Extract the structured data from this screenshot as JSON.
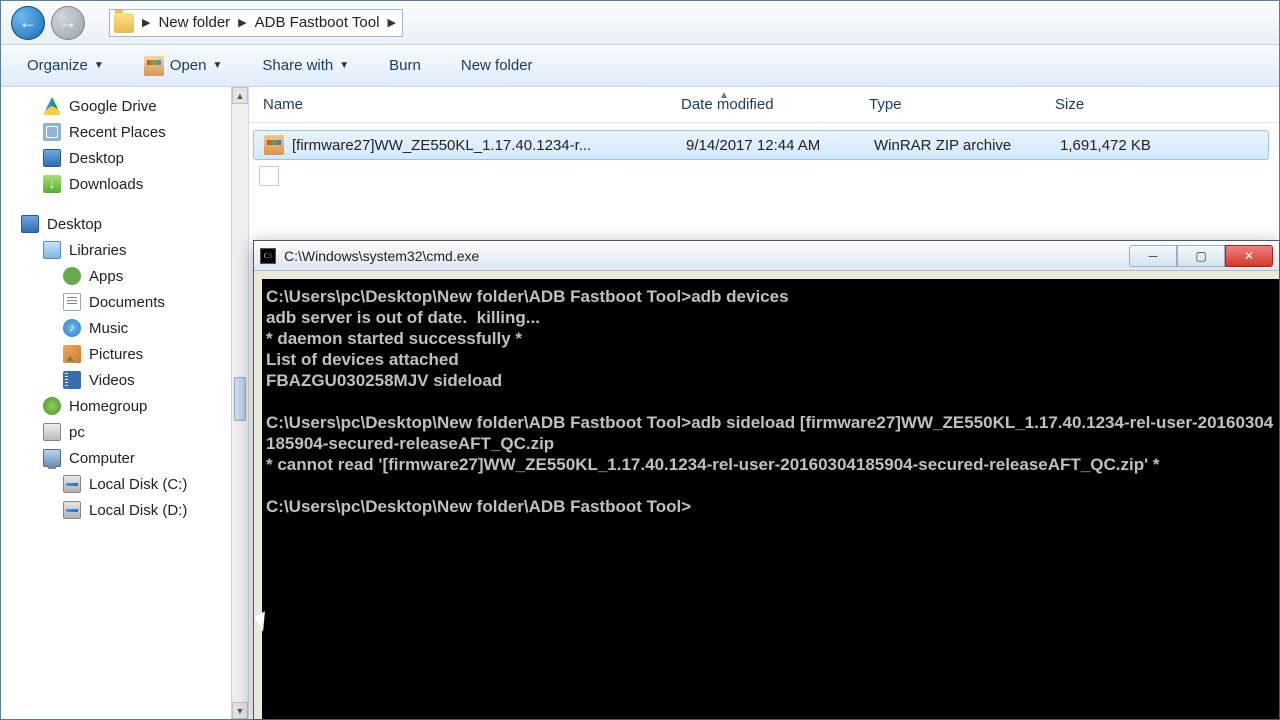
{
  "breadcrumb": {
    "seg1": "New folder",
    "seg2": "ADB Fastboot Tool"
  },
  "toolbar": {
    "organize": "Organize",
    "open": "Open",
    "share": "Share with",
    "burn": "Burn",
    "newfolder": "New folder"
  },
  "sidebar": {
    "gdrive": "Google Drive",
    "recent": "Recent Places",
    "desktop1": "Desktop",
    "downloads": "Downloads",
    "desktop2": "Desktop",
    "libraries": "Libraries",
    "apps": "Apps",
    "docs": "Documents",
    "music": "Music",
    "pics": "Pictures",
    "videos": "Videos",
    "home": "Homegroup",
    "pc": "pc",
    "computer": "Computer",
    "diskc": "Local Disk (C:)",
    "diskd": "Local Disk (D:)"
  },
  "cols": {
    "name": "Name",
    "date": "Date modified",
    "type": "Type",
    "size": "Size"
  },
  "files": {
    "r0": {
      "name": "[firmware27]WW_ZE550KL_1.17.40.1234-r...",
      "date": "9/14/2017 12:44 AM",
      "type": "WinRAR ZIP archive",
      "size": "1,691,472 KB"
    }
  },
  "cmd": {
    "title": "C:\\Windows\\system32\\cmd.exe",
    "l1": "C:\\Users\\pc\\Desktop\\New folder\\ADB Fastboot Tool>adb devices",
    "l2": "adb server is out of date.  killing...",
    "l3": "* daemon started successfully *",
    "l4": "List of devices attached",
    "l5": "FBAZGU030258MJV sideload",
    "l6": "",
    "l7": "C:\\Users\\pc\\Desktop\\New folder\\ADB Fastboot Tool>adb sideload [firmware27]WW_ZE550KL_1.17.40.1234-rel-user-20160304185904-secured-releaseAFT_QC.zip",
    "l8": "* cannot read '[firmware27]WW_ZE550KL_1.17.40.1234-rel-user-20160304185904-secured-releaseAFT_QC.zip' *",
    "l9": "",
    "l10": "C:\\Users\\pc\\Desktop\\New folder\\ADB Fastboot Tool>"
  }
}
